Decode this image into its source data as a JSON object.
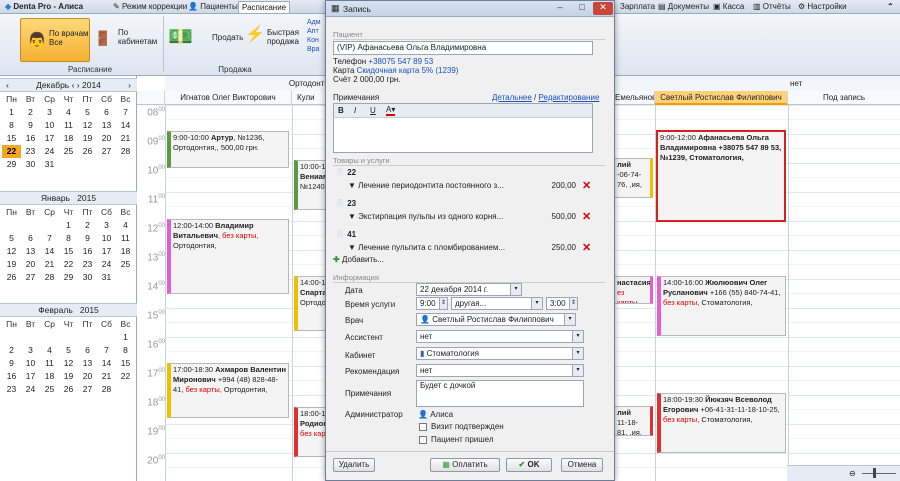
{
  "app": {
    "title": "Denta Pro - Алиса",
    "tabs": [
      "Режим коррекции",
      "Пациенты",
      "Расписание",
      "Зарплата",
      "Документы",
      "Касса",
      "Отчёты",
      "Настройки"
    ],
    "selected_tab": "Расписание"
  },
  "ribbon": {
    "by_doctor": "По врачам Все",
    "by_cabinet": "По кабинетам",
    "schedule_group": "Расписание",
    "sell": "Продать",
    "quick_sell": "Быстрая продажа",
    "sale_group": "Продажа",
    "links": [
      "Адм",
      "Апт",
      "Кон",
      "Вра"
    ]
  },
  "calendars": [
    {
      "month": "Декабрь",
      "year": "2014",
      "weekdays": [
        "Пн",
        "Вт",
        "Ср",
        "Чт",
        "Пт",
        "Сб",
        "Вс"
      ],
      "days": [
        "1",
        "2",
        "3",
        "4",
        "5",
        "6",
        "7",
        "8",
        "9",
        "10",
        "11",
        "12",
        "13",
        "14",
        "15",
        "16",
        "17",
        "18",
        "19",
        "20",
        "21",
        "22",
        "23",
        "24",
        "25",
        "26",
        "27",
        "28",
        "29",
        "30",
        "31",
        "",
        "",
        "",
        ""
      ],
      "today": "22"
    },
    {
      "month": "Январь",
      "year": "2015",
      "weekdays": [
        "Пн",
        "Вт",
        "Ср",
        "Чт",
        "Пт",
        "Сб",
        "Вс"
      ],
      "days": [
        "",
        "",
        "",
        "1",
        "2",
        "3",
        "4",
        "5",
        "6",
        "7",
        "8",
        "9",
        "10",
        "11",
        "12",
        "13",
        "14",
        "15",
        "16",
        "17",
        "18",
        "19",
        "20",
        "21",
        "22",
        "23",
        "24",
        "25",
        "26",
        "27",
        "28",
        "29",
        "30",
        "31",
        ""
      ]
    },
    {
      "month": "Февраль",
      "year": "2015",
      "weekdays": [
        "Пн",
        "Вт",
        "Ср",
        "Чт",
        "Пт",
        "Сб",
        "Вс"
      ],
      "days": [
        "",
        "",
        "",
        "",
        "",
        "",
        "1",
        "2",
        "3",
        "4",
        "5",
        "6",
        "7",
        "8",
        "9",
        "10",
        "11",
        "12",
        "13",
        "14",
        "15",
        "16",
        "17",
        "18",
        "19",
        "20",
        "21",
        "22",
        "23",
        "24",
        "25",
        "26",
        "27",
        "28",
        ""
      ]
    }
  ],
  "schedule": {
    "group_header": "Ортодонты",
    "right_header": "нет",
    "columns": [
      {
        "name": "Игнатов Олег Викторович"
      },
      {
        "name": "Кули"
      },
      {
        "name": "Емельянов"
      },
      {
        "name": "Светлый Ростислав Филиппович"
      },
      {
        "name": "Под запись"
      }
    ],
    "hours": [
      "08",
      "09",
      "10",
      "11",
      "12",
      "13",
      "14",
      "15",
      "16",
      "17",
      "18",
      "19",
      "20"
    ],
    "appointments": [
      {
        "time": "9:00-10:00",
        "name": "Артур",
        "detail": ", №1236, Ортодонтия,, 500,00 грн.",
        "color": "#5a9b3f"
      },
      {
        "time": "12:00-14:00",
        "name": "Владимир Витальевич",
        "red": ", без карты,",
        "detail": "Ортодонтия,",
        "color": "#e65cd6"
      },
      {
        "time": "17:00-18:30",
        "name": "Ахмаров Валентин Миронович",
        "detail": "+994 (48) 828-48-41,",
        "red": "без карты,",
        "detail2": "Ортодонтия,",
        "color": "#f0c000"
      },
      {
        "time": "10:00-12",
        "name": "Вениам",
        "detail": "№1240,",
        "color": "#5a9b3f"
      },
      {
        "time": "14:00-16",
        "name": "Спартак",
        "detail": "Ортодон",
        "color": "#f0c000"
      },
      {
        "time": "18:00-19",
        "name": "Родион",
        "red": "без кар",
        "color": "#e03030"
      },
      {
        "name": "лий",
        "detail": "-06-74-76, ,ия,",
        "color": "#f0c000"
      },
      {
        "name": "настасия",
        "red": "ез карты,",
        "color": "#e65cd6"
      },
      {
        "name": "лий",
        "detail": "11-18-81, ,ия,",
        "color": "#e03030"
      },
      {
        "time": "9:00-12:00",
        "name": "Афанасьева Ольга Владимировна",
        "detail": "+38075 547 89 53, №1239, Стоматология,",
        "color": "#d42020"
      },
      {
        "time": "14:00-16:00",
        "name": "Жюлюович Олег Русланович",
        "detail": "+166 (55) 840-74-41,",
        "red": "без карты,",
        "detail2": "Стоматология,",
        "color": "#e65cd6"
      },
      {
        "time": "18:00-19:30",
        "name": "Йюкзяч Всеволод Егорович",
        "detail": "+06-41-31-11-18-10-25,",
        "red": "без карты,",
        "detail2": "Стоматология,",
        "color": "#e03030"
      }
    ]
  },
  "dialog": {
    "title": "Запись",
    "patient_section": "Пациент",
    "patient": "(VIP) Афанасьева Ольга Владимировна",
    "phone_label": "Телефон",
    "phone": "+38075 547 89 53",
    "card_label": "Карта",
    "card": "Скидочная карта 5% (1239)",
    "account": "Счёт 2 000,00 грн.",
    "notes_label": "Примечания",
    "detailed": "Детальнее",
    "editing": "Редактирование",
    "services_section": "Товары и услуги",
    "teeth": [
      {
        "tooth": "22",
        "service": "Лечение периодонтита постоянного з...",
        "price": "200,00"
      },
      {
        "tooth": "23",
        "service": "Экстирпация пульпы из одного корня...",
        "price": "500,00"
      },
      {
        "tooth": "41",
        "service": "Лечение пульпита с пломбированием...",
        "price": "250,00"
      }
    ],
    "add": "Добавить...",
    "info_section": "Информация",
    "date_label": "Дата",
    "date": "22 декабря 2014 г.",
    "time_label": "Время услуги",
    "time_from": "9:00",
    "time_type": "другая...",
    "time_to": "3:00",
    "doctor_label": "Врач",
    "doctor": "Светлый Ростислав Филиппович",
    "assistant_label": "Ассистент",
    "assistant": "нет",
    "cabinet_label": "Кабинет",
    "cabinet": "Стоматология",
    "recommendation_label": "Рекомендация",
    "recommendation": "нет",
    "notes2_label": "Примечания",
    "notes2": "Будет с дочкой",
    "admin_label": "Администратор",
    "admin": "Алиса",
    "visit_confirmed": "Визит подтвержден",
    "patient_came": "Пациент пришел",
    "delete": "Удалить",
    "pay": "Оплатить",
    "ok": "OK",
    "cancel": "Отмена"
  },
  "statusbar": {
    "zoom": "100"
  }
}
